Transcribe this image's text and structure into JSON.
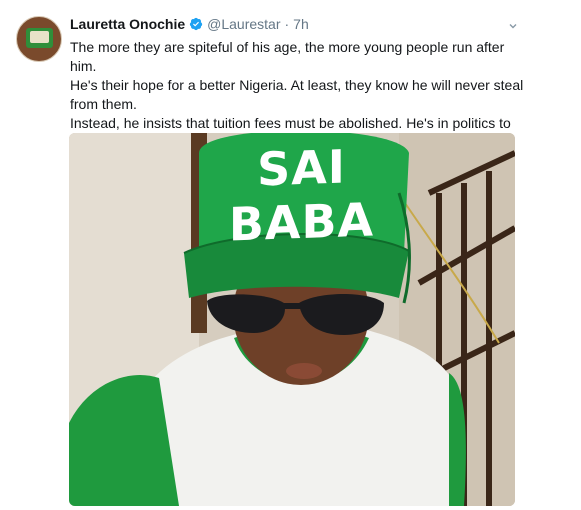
{
  "tweet": {
    "author_name": "Lauretta Onochie",
    "author_handle": "@Laurestar",
    "separator": "·",
    "time": "7h",
    "verified_icon": "verified-badge-icon",
    "caret_icon": "chevron-down-icon",
    "text_lines": [
      "The more they are spiteful of his age, the more young people run after him.",
      "He's their hope for a better Nigeria.  At least, they know he will never steal from them.",
      "Instead, he insists that tuition fees must be abolished. He's in politics to protect the future of our youth."
    ],
    "media": {
      "cap_text": "SAI BABA"
    }
  },
  "colors": {
    "cap_green": "#1fa64a",
    "verified_blue": "#1da1f2",
    "muted_text": "#657786"
  }
}
